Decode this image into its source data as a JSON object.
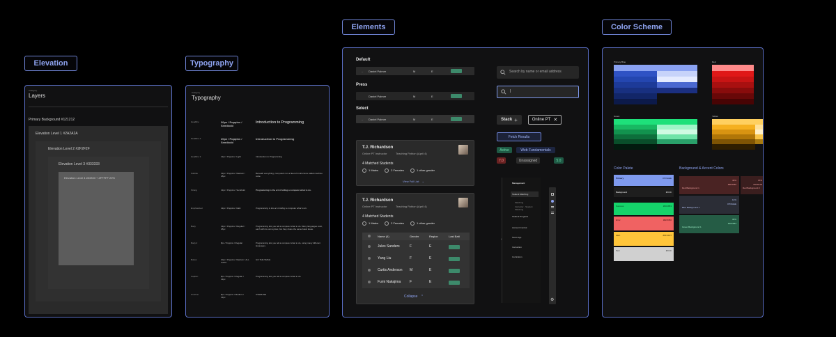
{
  "sections": {
    "elevation": "Elevation",
    "typography": "Typography",
    "elements": "Elements",
    "color_scheme": "Color Scheme"
  },
  "elevation": {
    "category": "Category",
    "title": "Layers",
    "primary": "Primary Background #121212",
    "level1": "Elevation Level 1 #2A2A2A",
    "level2": "Elevation Level 2 #2F2F2F",
    "level3": "Elevation Level 3 #333333",
    "level4": "Elevation Level 4 #33333 + #FFFFF 20%"
  },
  "typography": {
    "category": "Category",
    "title": "Typography",
    "rows": [
      {
        "name": "Headline",
        "spec": "30px / Poppins / Semibold",
        "sample": "Introduction to Programming"
      },
      {
        "name": "Headline 2",
        "spec": "20px / Poppins / Semibold",
        "sample": "Introduction to Programming"
      },
      {
        "name": "Headline 3",
        "spec": "12px / Poppins / Light",
        "sample": "Introduction to Programming"
      },
      {
        "name": "Subtitle",
        "spec": "12px / Poppins / Medium / 18px",
        "sample": "Beneath everything, computers run a fleet of instructions called machine code."
      },
      {
        "name": "Strong",
        "spec": "12px / Poppins / Semibold",
        "sample": "Programming is the art of telling a computer what to do."
      },
      {
        "name": "Emphasized",
        "spec": "12px / Poppins / Italic",
        "sample": "Programming is the art of telling a computer what to do."
      },
      {
        "name": "Body",
        "spec": "12px / Poppins / Regular / 18px",
        "sample": "Programming lets you tell a computer what to do. Many languages exist, each with its own syntax, but they share the same basic ideas."
      },
      {
        "name": "Body 2",
        "spec": "8px / Poppins / Regular",
        "sample": "Programming lets you tell a computer what to do, using many different languages."
      },
      {
        "name": "Button",
        "spec": "10px / Poppins / Medium / ALL CAPS",
        "sample": "GO THE SMILE"
      },
      {
        "name": "Caption",
        "spec": "8px / Poppins / Regular / 12px",
        "sample": "Programming lets you tell a computer what to do."
      },
      {
        "name": "Overline",
        "spec": "8px / Poppins / Medium / 12px",
        "sample": "OVERLINE"
      }
    ]
  },
  "elements": {
    "default_label": "Default",
    "press_label": "Press",
    "select_label": "Select",
    "row_name": "Daniel Palmer",
    "row_gender": "M",
    "row_region": "E",
    "search_placeholder": "Search by name or email address",
    "search_active": "|",
    "stack_label": "Stack",
    "online_pt": "Online PT",
    "fetch_results": "Fetch Results",
    "tags": [
      "Active",
      "Web Fundamentals",
      "7.0",
      "Unassigned",
      "5.0"
    ],
    "card1": {
      "name": "T.J. Richardson",
      "role": "Online PT Instructor",
      "course": "Teaching Python (April 4)",
      "matched": "4 Matched Students",
      "males": "1 Males",
      "females": "2 Females",
      "other": "1 other gender",
      "link": "View Full List"
    },
    "card2": {
      "name": "T.J. Richardson",
      "role": "Online PT Instructor",
      "course": "Teaching Python (April 4)",
      "matched": "4 Matched Students",
      "males": "1 Males",
      "females": "2 Females",
      "other": "1 other gender",
      "columns": [
        "Name (4)",
        "Gender",
        "Region",
        "Last Batt"
      ],
      "students": [
        {
          "name": "Jules Sanders",
          "gender": "F",
          "region": "E"
        },
        {
          "name": "Yang Liu",
          "gender": "F",
          "region": "E"
        },
        {
          "name": "Curtis Anderson",
          "gender": "M",
          "region": "E"
        },
        {
          "name": "Fumi Nakajima",
          "gender": "F",
          "region": "E"
        }
      ],
      "collapse": "Collapse"
    },
    "menu": {
      "title": "Management",
      "items": [
        "Student Matching",
        "Matching",
        "Instructor · Student Matching",
        "Student Progress",
        "Account Control",
        "Team App",
        "Instruction",
        "Curriculum"
      ]
    }
  },
  "colors": {
    "palettes": [
      {
        "name": "Primary Blue",
        "colors": [
          "#8aa2f2",
          "#2f52c4",
          "#2446b0",
          "#1d3a98",
          "#183080",
          "#122668",
          "#0c1a4a"
        ]
      },
      {
        "name": "Red",
        "colors": [
          "#ff8a8a",
          "#e01818",
          "#c81414",
          "#a81010",
          "#880c0c",
          "#680808",
          "#480404"
        ]
      },
      {
        "name": "Green",
        "colors": [
          "#1ee07a",
          "#18b862",
          "#12924e",
          "#0d6e3b",
          "#094e2a",
          "#05321b",
          "#021a0e"
        ]
      },
      {
        "name": "Yellow",
        "colors": [
          "#ffd060",
          "#f5b020",
          "#d89412",
          "#b07608",
          "#7e5404",
          "#553802",
          "#2e1e00"
        ]
      }
    ],
    "palette_title": "Color Palete",
    "palette_items": [
      {
        "name": "Primary",
        "hex": "#7F9AEE",
        "color": "#7f9aee"
      },
      {
        "name": "Background",
        "hex": "#CCC",
        "color": "#1e1e1e"
      },
      {
        "name": "Success",
        "hex": "#00C853",
        "color": "#15d36a"
      },
      {
        "name": "Error",
        "hex": "#EF5350",
        "color": "#f06262"
      },
      {
        "name": "Alert",
        "hex": "#FFC107",
        "color": "#ffc53a"
      },
      {
        "name": "Text",
        "hex": "#CCC",
        "color": "#d0d0d0"
      }
    ],
    "bg_title": "Background & Accent Colors",
    "bg_items": [
      {
        "name": "Red Background 1",
        "pct": "40%",
        "hex": "#EF5350",
        "color": "#4a2323"
      },
      {
        "name": "Red Background 2",
        "pct": "15%",
        "hex": "#3A1E1E",
        "color": "#3a1e1e"
      },
      {
        "name": "Blue Background 1",
        "pct": "14%",
        "hex": "#7F9AEE",
        "color": "#2b2d36"
      },
      {
        "name": "Green Background 1",
        "pct": "30%",
        "hex": "#00C853",
        "color": "#255c45"
      }
    ]
  }
}
